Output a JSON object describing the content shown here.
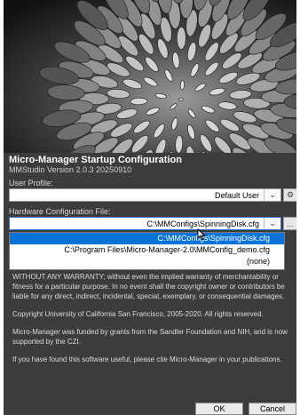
{
  "app": {
    "title": "Micro-Manager Startup Configuration",
    "version": "MMStudio Version 2.0.3 20250910"
  },
  "user_profile": {
    "label": "User Profile:",
    "value": "Default User",
    "settings_icon": "gear-icon"
  },
  "hardware_config": {
    "label": "Hardware Configuration File:",
    "value": "C:\\MMConfigs\\SpinningDisk.cfg",
    "browse_label": "...",
    "options": [
      {
        "label": "C:\\MMConfigs\\SpinningDisk.cfg",
        "selected": true
      },
      {
        "label": "C:\\Program Files\\Micro-Manager-2.0\\MMConfig_demo.cfg",
        "selected": false
      },
      {
        "label": "(none)",
        "selected": false
      }
    ]
  },
  "license": {
    "paragraph1": "WITHOUT ANY WARRANTY; without even the implied warranty of merchantability or fitness for a particular purpose. In no event shall the copyright owner or contributors be liable for any direct, indirect, incidental, special, exemplary, or consequential damages.",
    "paragraph2": "Copyright University of California San Francisco, 2005-2020. All rights reserved.",
    "paragraph3": "Micro-Manager was funded by grants from the Sandler Foundation and NIH, and is now supported by the CZI.",
    "paragraph4": "If you have found this software useful, please cite Micro-Manager in your publications."
  },
  "buttons": {
    "ok": "OK",
    "cancel": "Cancel"
  },
  "colors": {
    "dialog_bg": "#3c3c3c",
    "selection": "#0a73d9"
  }
}
